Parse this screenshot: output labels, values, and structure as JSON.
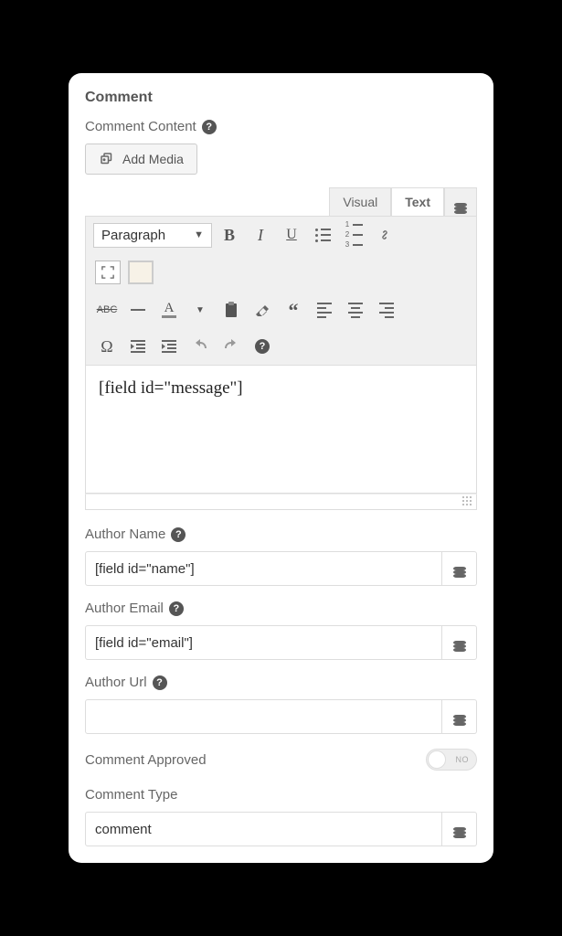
{
  "section_title": "Comment",
  "content": {
    "label": "Comment Content",
    "add_media_label": "Add Media",
    "tabs": {
      "visual": "Visual",
      "text": "Text"
    },
    "format_dropdown": "Paragraph",
    "editor_value": "[field id=\"message\"]"
  },
  "author_name": {
    "label": "Author Name",
    "value": "[field id=\"name\"]"
  },
  "author_email": {
    "label": "Author Email",
    "value": "[field id=\"email\"]"
  },
  "author_url": {
    "label": "Author Url",
    "value": ""
  },
  "approved": {
    "label": "Comment Approved",
    "state_label": "NO"
  },
  "comment_type": {
    "label": "Comment Type",
    "value": "comment"
  }
}
